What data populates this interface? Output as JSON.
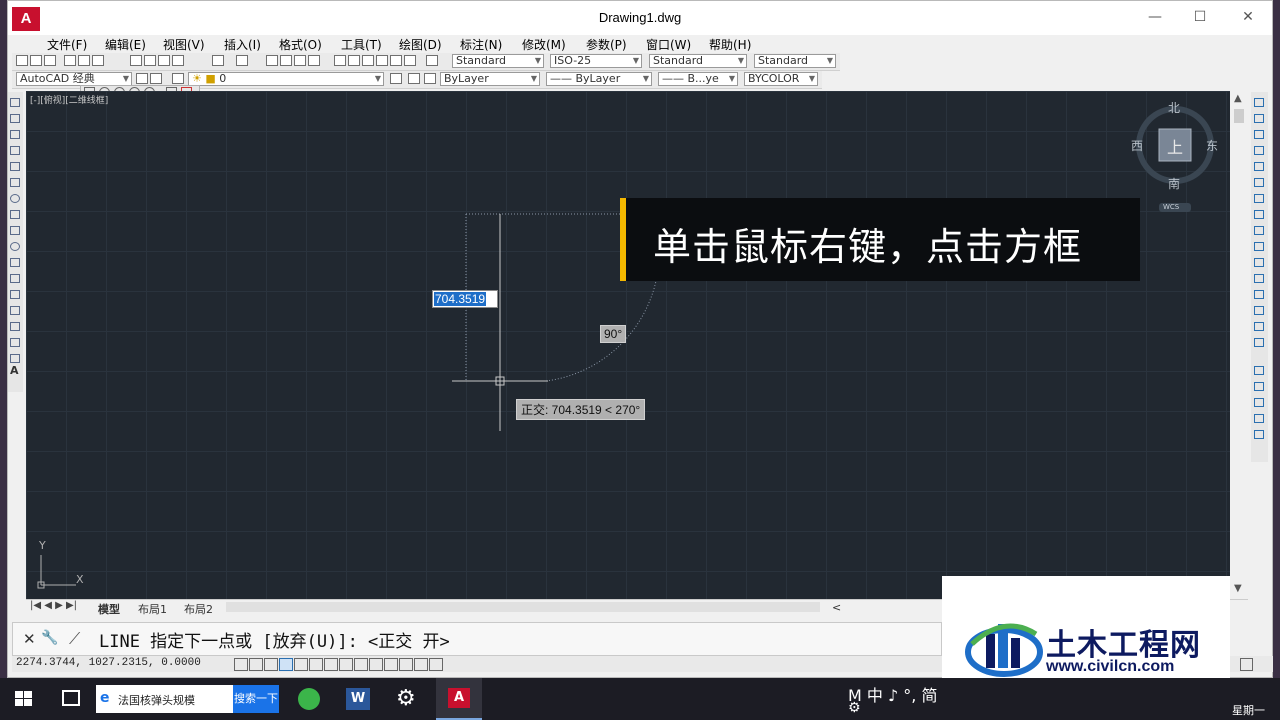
{
  "window": {
    "title": "Drawing1.dwg",
    "logo_text": "A",
    "minimize": "—",
    "maximize": "☐",
    "close": "✕"
  },
  "menu": [
    "文件(F)",
    "编辑(E)",
    "视图(V)",
    "插入(I)",
    "格式(O)",
    "工具(T)",
    "绘图(D)",
    "标注(N)",
    "修改(M)",
    "参数(P)",
    "窗口(W)",
    "帮助(H)"
  ],
  "toolbar1": {
    "text_style": "Standard",
    "dim_style": "ISO-25",
    "table_style": "Standard",
    "multileader_style": "Standard"
  },
  "toolbar2": {
    "workspace": "AutoCAD 经典",
    "layer": "0",
    "color": "ByLayer",
    "linetype": "ByLayer",
    "lineweight": "B...ye",
    "plotstyle": "BYCOLOR"
  },
  "canvas": {
    "view_label": "[-][俯视][二维线框]",
    "dynamic_input_value": "704.3519",
    "angle_label": "90°",
    "tooltip": "正交: 704.3519 < 270°",
    "ucs_x": "X",
    "ucs_y": "Y"
  },
  "viewcube": {
    "north": "北",
    "south": "南",
    "east": "东",
    "west": "西",
    "top": "上",
    "wcs": "WCS"
  },
  "caption": {
    "text": "单击鼠标右键，点击方框"
  },
  "tabs": [
    "模型",
    "布局1",
    "布局2"
  ],
  "scroll_left": "<",
  "command": {
    "text": "LINE 指定下一点或 [放弃(U)]:  <正交 开>"
  },
  "status": {
    "coords": "2274.3744, 1027.2315, 0.0000"
  },
  "watermark": {
    "name": "土木工程网",
    "url": "www.civilcn.com"
  },
  "taskbar": {
    "search_text": "法国核弹头规模",
    "search_button": "搜索一下",
    "ime": "M 中 ♪ °, 简",
    "day": "星期一"
  },
  "colors": {
    "canvas_bg": "#212830",
    "caption_accent": "#f5b800",
    "dyn_input_bg": "#1e6ec8",
    "watermark_text": "#0d1a60"
  }
}
